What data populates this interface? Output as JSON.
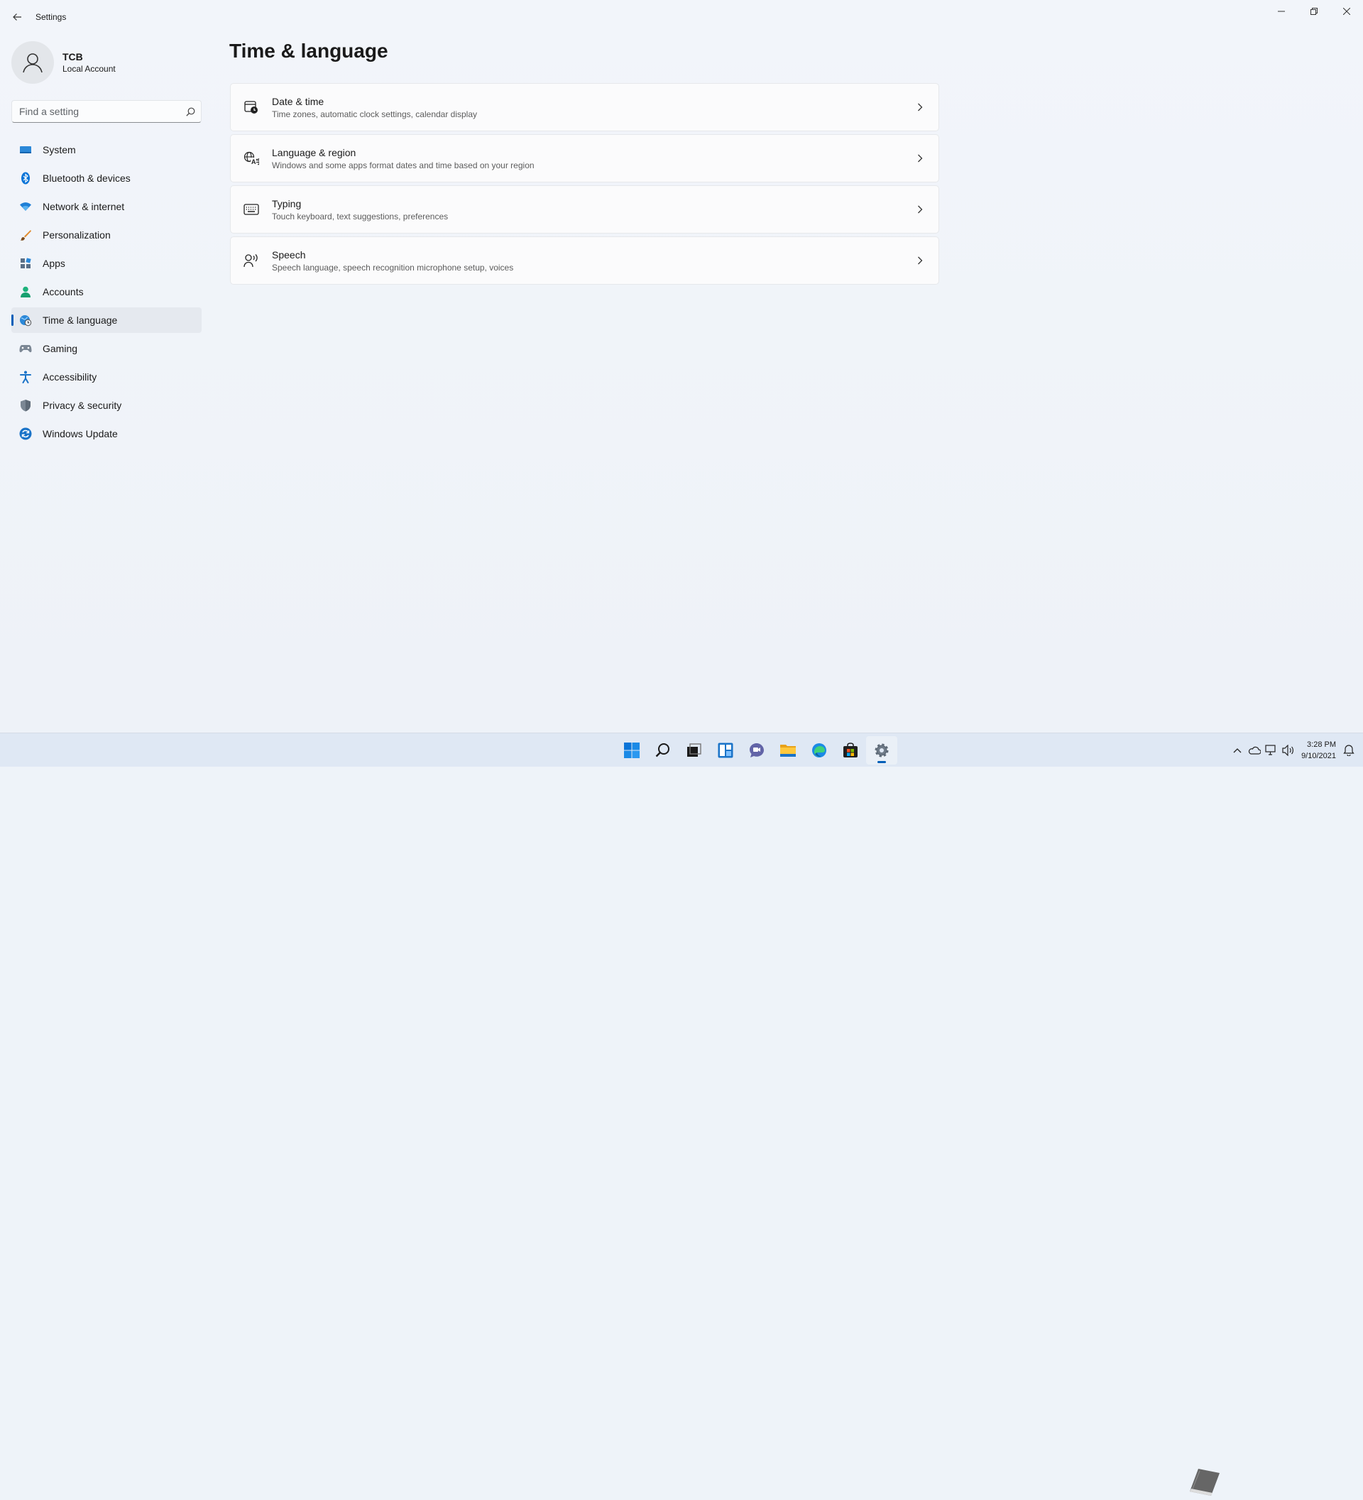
{
  "window": {
    "title": "Settings",
    "controls": [
      "minimize",
      "restore",
      "close"
    ]
  },
  "profile": {
    "name": "TCB",
    "account_type": "Local Account"
  },
  "search": {
    "placeholder": "Find a setting",
    "value": ""
  },
  "sidebar": {
    "items": [
      {
        "label": "System",
        "icon": "monitor-icon"
      },
      {
        "label": "Bluetooth & devices",
        "icon": "bluetooth-icon"
      },
      {
        "label": "Network & internet",
        "icon": "wifi-icon"
      },
      {
        "label": "Personalization",
        "icon": "brush-icon"
      },
      {
        "label": "Apps",
        "icon": "apps-icon"
      },
      {
        "label": "Accounts",
        "icon": "person-icon"
      },
      {
        "label": "Time & language",
        "icon": "globe-clock-icon",
        "selected": true
      },
      {
        "label": "Gaming",
        "icon": "gamepad-icon"
      },
      {
        "label": "Accessibility",
        "icon": "accessibility-icon"
      },
      {
        "label": "Privacy & security",
        "icon": "shield-icon"
      },
      {
        "label": "Windows Update",
        "icon": "update-icon"
      }
    ]
  },
  "main": {
    "title": "Time & language",
    "cards": [
      {
        "title": "Date & time",
        "description": "Time zones, automatic clock settings, calendar display",
        "icon": "calendar-clock-icon"
      },
      {
        "title": "Language & region",
        "description": "Windows and some apps format dates and time based on your region",
        "icon": "language-icon"
      },
      {
        "title": "Typing",
        "description": "Touch keyboard, text suggestions, preferences",
        "icon": "keyboard-icon"
      },
      {
        "title": "Speech",
        "description": "Speech language, speech recognition microphone setup, voices",
        "icon": "speech-icon"
      }
    ]
  },
  "taskbar": {
    "apps": [
      "start-icon",
      "search-icon",
      "task-view-icon",
      "widgets-icon",
      "chat-icon",
      "file-explorer-icon",
      "edge-icon",
      "store-icon",
      "settings-icon"
    ],
    "active_app": "settings-icon",
    "clock": {
      "time": "3:28 PM",
      "date": "9/10/2021"
    }
  },
  "colors": {
    "accent": "#005fb8",
    "background": "#eff4f9"
  }
}
